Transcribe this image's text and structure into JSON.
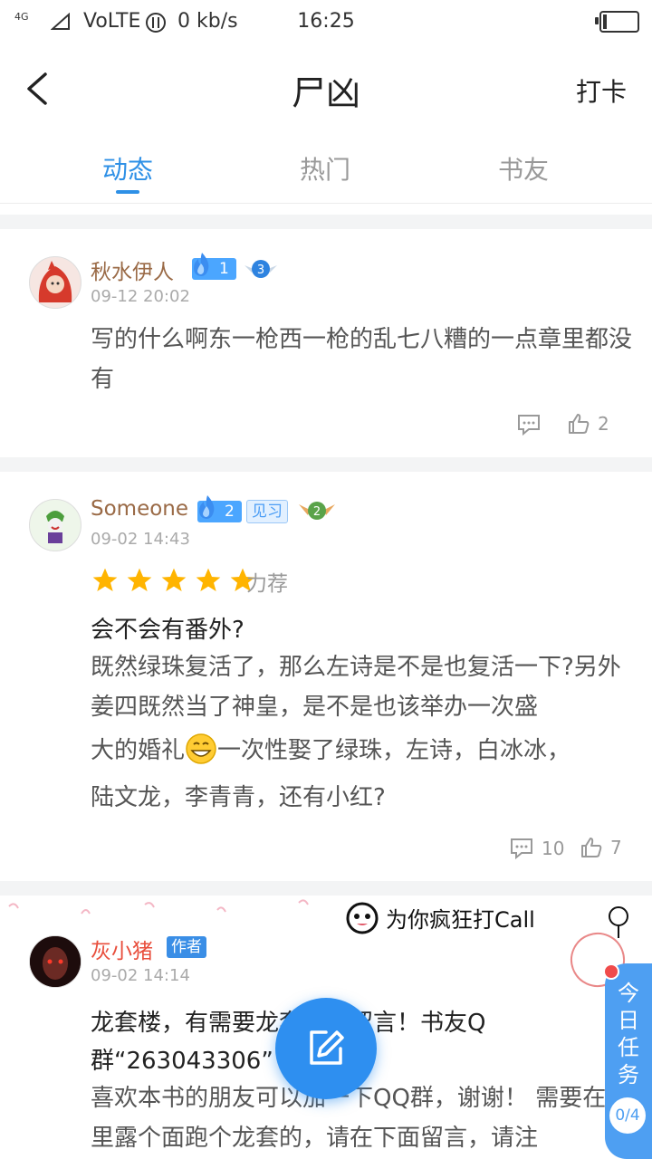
{
  "status_bar": {
    "network": "4G",
    "volte": "VoLTE",
    "speed": "0 kb/s",
    "time": "16:25"
  },
  "header": {
    "title": "尸凶",
    "checkin_label": "打卡"
  },
  "tabs": [
    {
      "label": "动态",
      "active": true
    },
    {
      "label": "热门",
      "active": false
    },
    {
      "label": "书友",
      "active": false
    }
  ],
  "posts": [
    {
      "user": "秋水伊人",
      "level": "1",
      "medal_level": "3",
      "date": "09-12 20:02",
      "content": "写的什么啊东一枪西一枪的乱七八糟的一点章里都没有",
      "comments": "",
      "likes": "2"
    },
    {
      "user": "Someone",
      "level": "2",
      "tag": "见习",
      "medal_level": "2",
      "date": "09-02 14:43",
      "rating": 5,
      "rating_label": "力荐",
      "title": "会不会有番外?",
      "content_1": "既然绿珠复活了，那么左诗是不是也复活一下?另外姜四既然当了神皇，是不是也该举办一次盛",
      "content_2a": "大的婚礼",
      "content_2b": "一次性娶了绿珠，左诗，白冰冰，",
      "content_3": "陆文龙，李青青，还有小红?",
      "comments": "10",
      "likes": "7"
    },
    {
      "user": "灰小猪",
      "tag": "作者",
      "date": "09-02 14:14",
      "title_1": "龙套楼，有需要龙套的请留言！书友Q",
      "title_2": "群“263043306”",
      "content": "喜欢本书的朋友可以加一下QQ群，谢谢！ 需要在书里露个面跑个龙套的，请在下面留言，请注"
    }
  ],
  "banner_text": "为你疯狂打Call",
  "task_widget": {
    "label": "今日任务",
    "count": "0/4"
  },
  "colors": {
    "accent": "#2e90e6",
    "username": "#9a6a46",
    "author": "#e84e3c",
    "star": "#ffb400"
  }
}
